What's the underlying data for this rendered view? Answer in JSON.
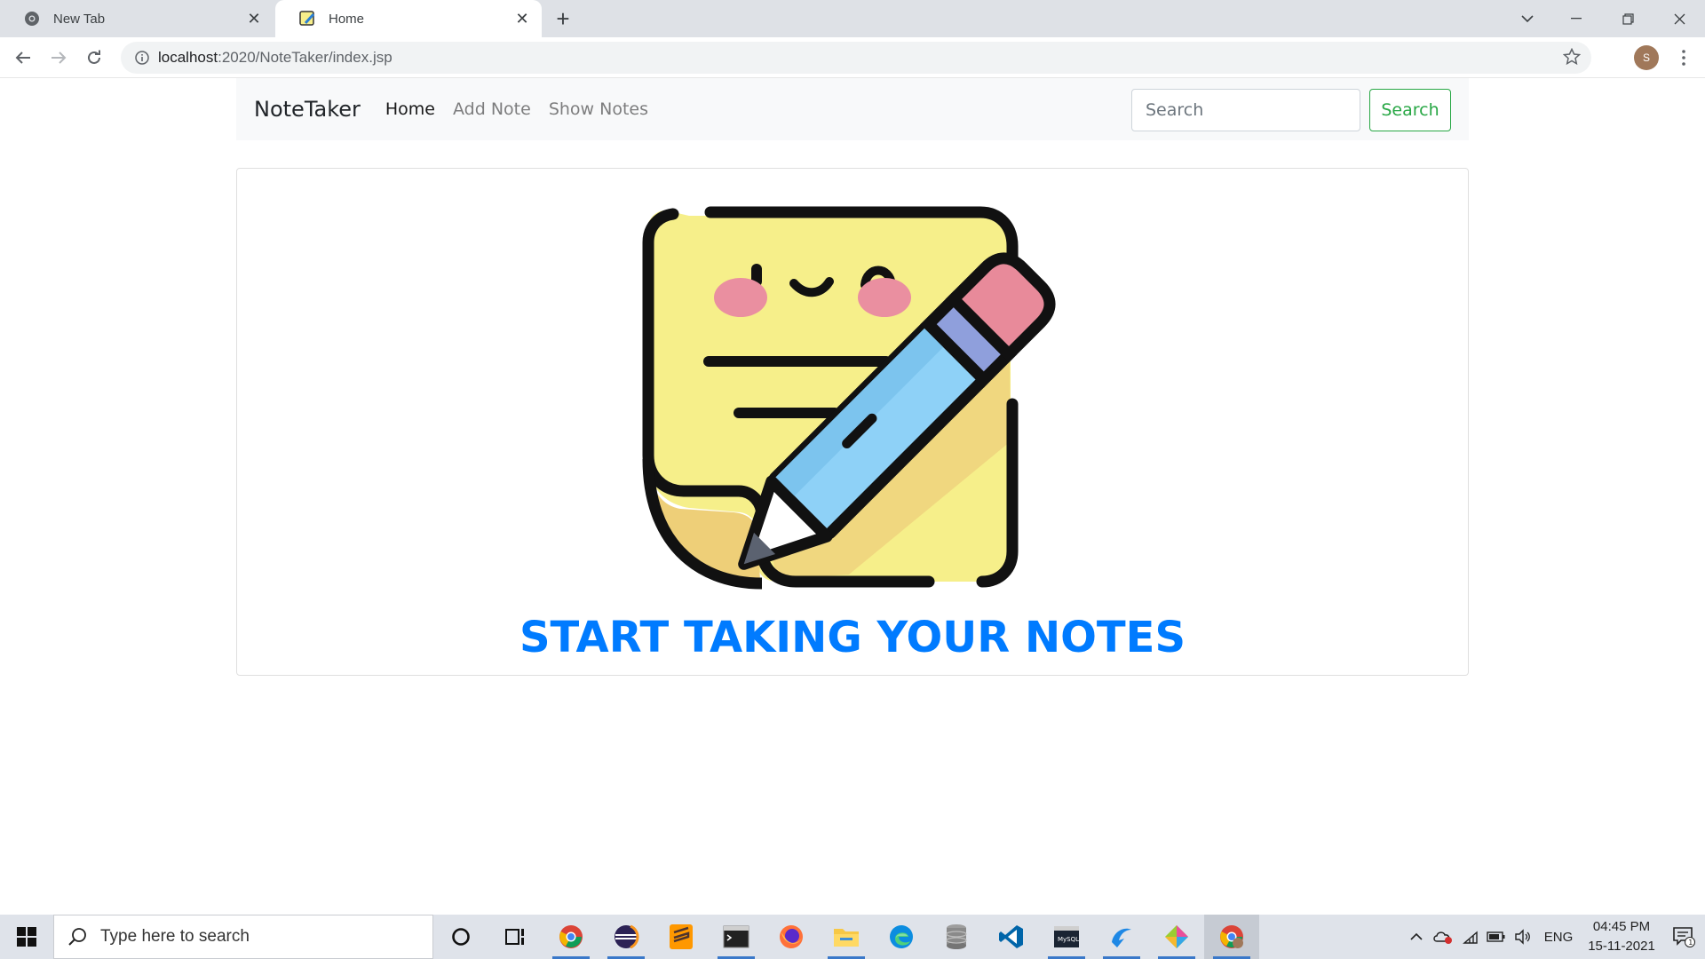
{
  "browser": {
    "tabs": [
      {
        "title": "New Tab",
        "icon": "chrome-icon",
        "active": false
      },
      {
        "title": "Home",
        "icon": "notes-favicon",
        "active": true
      }
    ],
    "url_host": "localhost",
    "url_path": ":2020/NoteTaker/index.jsp",
    "profile_initial": "S"
  },
  "navbar": {
    "brand": "NoteTaker",
    "links": [
      {
        "label": "Home",
        "active": true
      },
      {
        "label": "Add Note",
        "active": false
      },
      {
        "label": "Show Notes",
        "active": false
      }
    ],
    "search_placeholder": "Search",
    "search_button": "Search"
  },
  "main": {
    "heading": "START TAKING YOUR NOTES",
    "hero_icon": "sticky-note-pencil-icon"
  },
  "taskbar": {
    "search_placeholder": "Type here to search",
    "language": "ENG",
    "time": "04:45 PM",
    "date": "15-11-2021",
    "notification_count": "1",
    "apps": [
      "cortana-icon",
      "task-view-icon",
      "chrome-icon",
      "eclipse-icon",
      "sublime-icon",
      "terminal-icon",
      "firefox-icon",
      "file-explorer-icon",
      "edge-icon",
      "database-icon",
      "vscode-icon",
      "mysql-icon",
      "browser-icon",
      "tool-icon",
      "chrome-profile-icon"
    ]
  },
  "colors": {
    "brand_blue": "#007bff",
    "success_green": "#28a745",
    "note_yellow": "#f7ee8a",
    "pencil_blue": "#8fd3f7",
    "eraser_pink": "#e58a9a"
  }
}
